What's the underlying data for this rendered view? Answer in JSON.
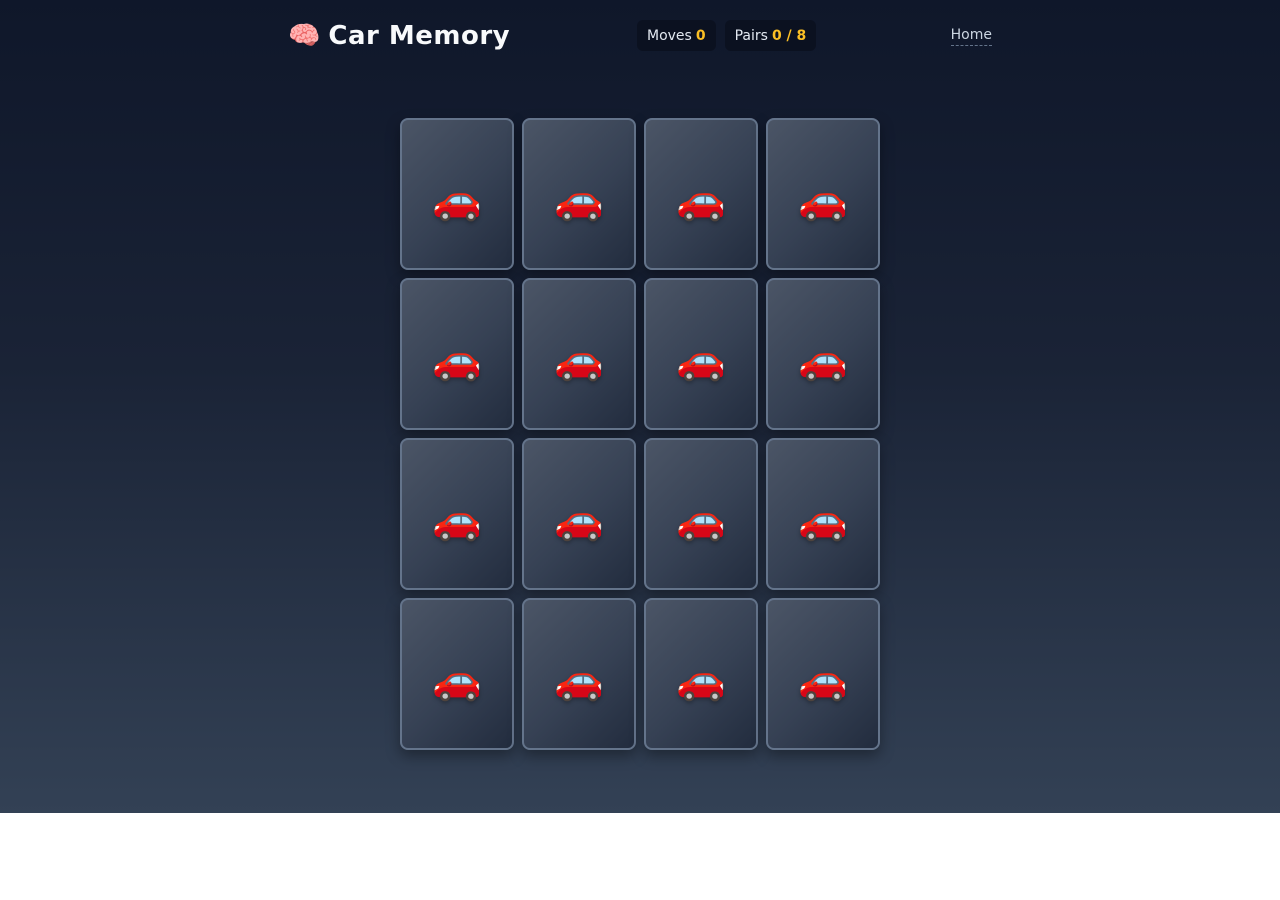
{
  "header": {
    "brand_icon": "🧠",
    "title": "Car Memory",
    "moves_label": "Moves",
    "moves_value": "0",
    "pairs_label": "Pairs",
    "pairs_value": "0 / 8",
    "home_link": "Home"
  },
  "board": {
    "card_back_icon": "car-icon",
    "cards": [
      {
        "face": "🚗"
      },
      {
        "face": "🚗"
      },
      {
        "face": "🚗"
      },
      {
        "face": "🚗"
      },
      {
        "face": "🚗"
      },
      {
        "face": "🚗"
      },
      {
        "face": "🚗"
      },
      {
        "face": "🚗"
      },
      {
        "face": "🚗"
      },
      {
        "face": "🚗"
      },
      {
        "face": "🚗"
      },
      {
        "face": "🚗"
      },
      {
        "face": "🚗"
      },
      {
        "face": "🚗"
      },
      {
        "face": "🚗"
      },
      {
        "face": "🚗"
      }
    ]
  },
  "colors": {
    "accent": "#fbbf24",
    "background_top": "#0f172a",
    "background_bottom": "#334155"
  }
}
